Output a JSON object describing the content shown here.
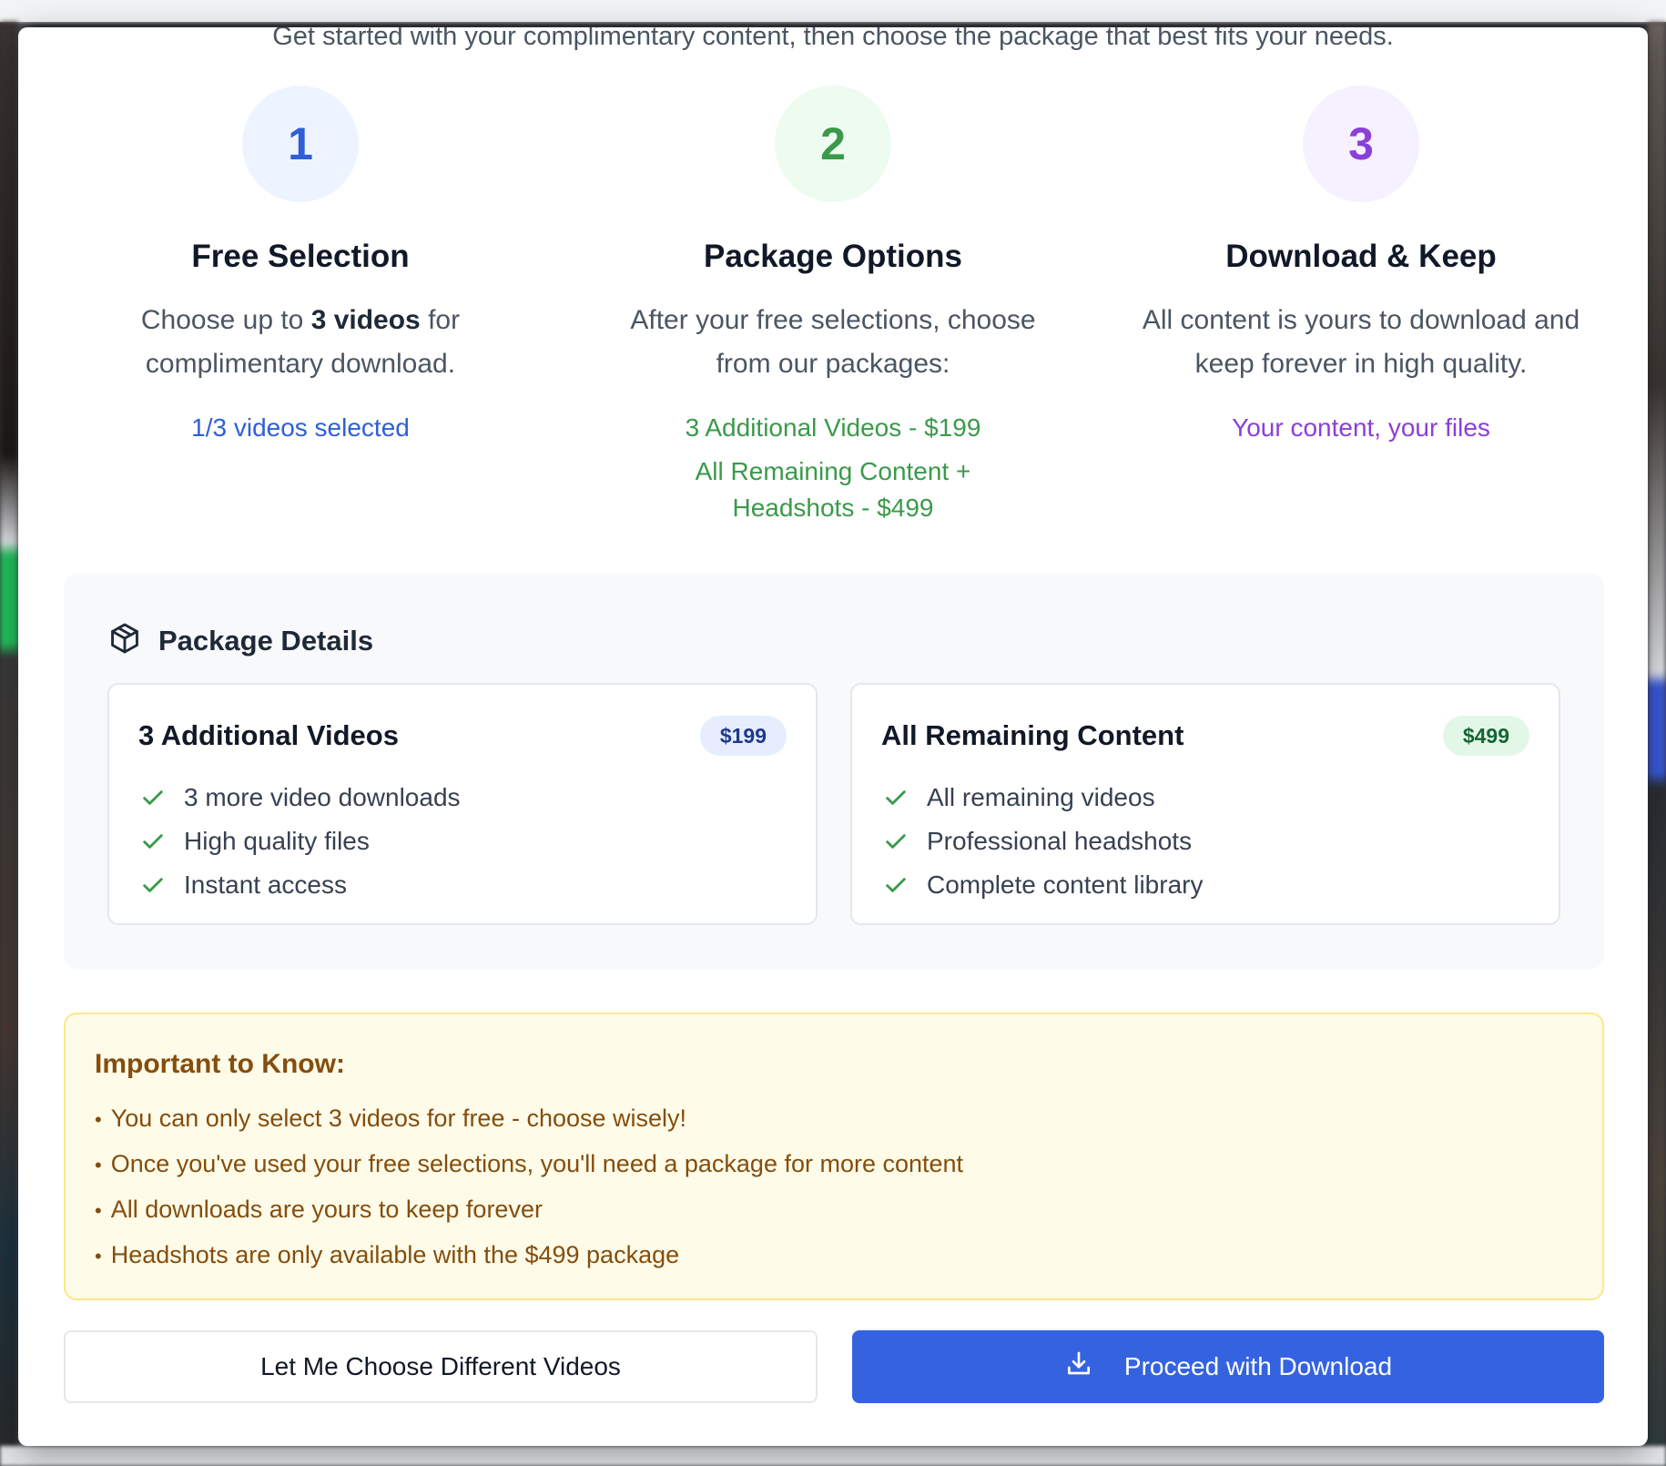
{
  "intro": "Get started with your complimentary content, then choose the package that best fits your needs.",
  "steps": [
    {
      "number": "1",
      "title": "Free Selection",
      "desc_pre": "Choose up to ",
      "desc_bold": "3 videos",
      "desc_post": " for complimentary download.",
      "note": "1/3 videos selected",
      "color": "#2f5fd6",
      "bg": "#eef4ff"
    },
    {
      "number": "2",
      "title": "Package Options",
      "desc": "After your free selections, choose from our packages:",
      "note": "3 Additional Videos - $199",
      "note2": "All Remaining Content + Headshots - $499",
      "color": "#3a9a4a",
      "bg": "#eefbf1"
    },
    {
      "number": "3",
      "title": "Download & Keep",
      "desc": "All content is yours to download and keep forever in high quality.",
      "note": "Your content, your files",
      "color": "#8b3fd9",
      "bg": "#f6f1ff"
    }
  ],
  "package_details": {
    "title": "Package Details",
    "icon": "package-icon",
    "cards": [
      {
        "title": "3 Additional Videos",
        "price": "$199",
        "badge_bg": "#e6edff",
        "badge_color": "#1e3a8a",
        "features": [
          "3 more video downloads",
          "High quality files",
          "Instant access"
        ]
      },
      {
        "title": "All Remaining Content",
        "price": "$499",
        "badge_bg": "#e3f7e8",
        "badge_color": "#166534",
        "features": [
          "All remaining videos",
          "Professional headshots",
          "Complete content library"
        ]
      }
    ]
  },
  "notice": {
    "title": "Important to Know:",
    "items": [
      "You can only select 3 videos for free - choose wisely!",
      "Once you've used your free selections, you'll need a package for more content",
      "All downloads are yours to keep forever",
      "Headshots are only available with the $499 package"
    ]
  },
  "buttons": {
    "secondary": "Let Me Choose Different Videos",
    "primary": "Proceed with Download",
    "primary_icon": "download-icon"
  },
  "colors": {
    "check": "#3a9a4a",
    "primary": "#3563e0",
    "notice_text": "#854d0e"
  }
}
